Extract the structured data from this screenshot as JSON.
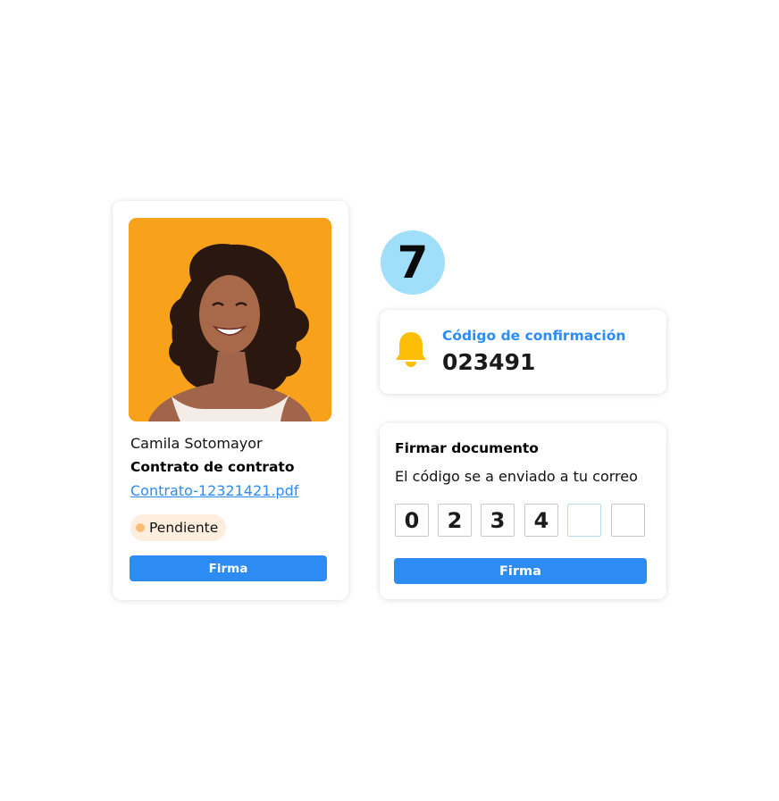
{
  "profile": {
    "name": "Camila Sotomayor",
    "document_title": "Contrato de contrato",
    "file_link": "Contrato-12321421.pdf",
    "status": "Pendiente",
    "sign_button": "Firma"
  },
  "step": {
    "number": "7"
  },
  "confirmation": {
    "label": "Código de confirmación",
    "code": "023491"
  },
  "sign": {
    "title": "Firmar documento",
    "subtitle": "El código se a enviado a tu correo",
    "digits": [
      "0",
      "2",
      "3",
      "4",
      "",
      ""
    ],
    "button": "Firma"
  },
  "colors": {
    "accent": "#2d8cf3",
    "photo_background": "#f8a21c",
    "step_badge": "#9fdff9",
    "status_background": "#fdeede",
    "status_dot": "#fbbd74",
    "bell": "#fcbf06"
  },
  "icons": [
    "bell-icon",
    "status-dot-icon"
  ]
}
